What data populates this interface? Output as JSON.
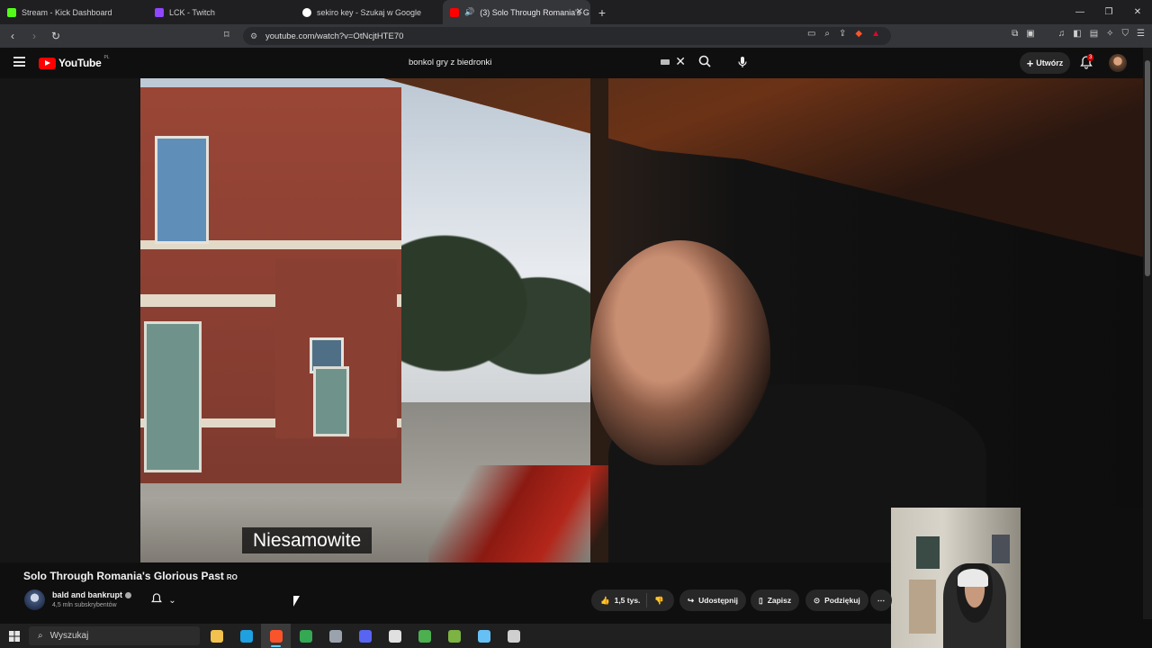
{
  "browser": {
    "tabs": [
      {
        "label": "Stream - Kick Dashboard",
        "icon": "kick-icon",
        "color": "#53fc18",
        "active": false
      },
      {
        "label": "LCK - Twitch",
        "icon": "twitch-icon",
        "color": "#9146ff",
        "active": false
      },
      {
        "label": "sekiro key - Szukaj w Google",
        "icon": "google-icon",
        "color": "#4285f4",
        "active": false
      },
      {
        "label": "(3) Solo Through Romania's G",
        "icon": "youtube-icon",
        "color": "#ff0000",
        "active": true
      }
    ],
    "url": "youtube.com/watch?v=OtNcjtHTE70"
  },
  "youtube": {
    "logo_text": "YouTube",
    "logo_region": "PL",
    "search_value": "bonkol gry z biedronki",
    "create_label": "Utwórz",
    "notifications_count": "3"
  },
  "video": {
    "subtitle": "Niesamowite",
    "title": "Solo Through Romania's Glorious Past",
    "title_tag": "RO",
    "channel_name": "bald and bankrupt",
    "channel_subs": "4,5 mln subskrybentów",
    "likes": "1,5 tys.",
    "share_label": "Udostępnij",
    "save_label": "Zapisz",
    "thanks_label": "Podziękuj"
  },
  "taskbar": {
    "search_placeholder": "Wyszukaj",
    "apps": [
      {
        "name": "file-explorer-icon",
        "color": "#f2c14e"
      },
      {
        "name": "edge-icon",
        "color": "#1fa0e0"
      },
      {
        "name": "brave-icon",
        "color": "#fb542b",
        "active": true
      },
      {
        "name": "chrome-icon",
        "color": "#34a853"
      },
      {
        "name": "notepad-icon",
        "color": "#9aa3ad"
      },
      {
        "name": "discord-icon",
        "color": "#5865f2"
      },
      {
        "name": "obs-icon",
        "color": "#e0e0e0"
      },
      {
        "name": "media-player-icon",
        "color": "#4caf50"
      },
      {
        "name": "game-launcher-icon",
        "color": "#7cb342"
      },
      {
        "name": "steam-icon",
        "color": "#66c0f4"
      },
      {
        "name": "app-icon",
        "color": "#cfcfcf"
      }
    ]
  }
}
